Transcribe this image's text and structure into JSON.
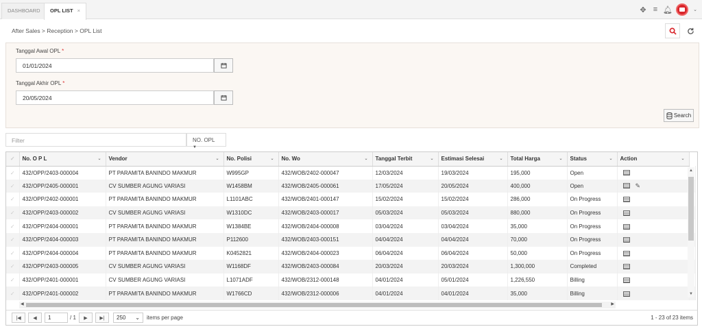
{
  "tabs": [
    {
      "label": "DASHBOARD"
    },
    {
      "label": "OPL LIST",
      "close": "×"
    }
  ],
  "breadcrumb": "After Sales > Reception > OPL List",
  "form": {
    "start_label": "Tanggal Awal OPL",
    "start_value": "01/01/2024",
    "end_label": "Tanggal Akhir OPL",
    "end_value": "20/05/2024",
    "required_mark": "*",
    "search_label": "Search"
  },
  "filter": {
    "placeholder": "Filter",
    "column": "NO. OPL"
  },
  "table": {
    "columns": [
      "No. O P L",
      "Vendor",
      "No. Polisi",
      "No. Wo",
      "Tanggal Terbit",
      "Estimasi Selesai",
      "Total Harga",
      "Status",
      "Action"
    ],
    "rows": [
      [
        "432/OPP/2403-000004",
        "PT PARAMITA BANINDO MAKMUR",
        "W995GP",
        "432/WOB/2402-000047",
        "12/03/2024",
        "19/03/2024",
        "195,000",
        "Open"
      ],
      [
        "432/OPP/2405-000001",
        "CV SUMBER AGUNG VARIASI",
        "W1458BM",
        "432/WOB/2405-000061",
        "17/05/2024",
        "20/05/2024",
        "400,000",
        "Open"
      ],
      [
        "432/OPP/2402-000001",
        "PT PARAMITA BANINDO MAKMUR",
        "L1101ABC",
        "432/WOB/2401-000147",
        "15/02/2024",
        "15/02/2024",
        "286,000",
        "On Progress"
      ],
      [
        "432/OPP/2403-000002",
        "CV SUMBER AGUNG VARIASI",
        "W1310DC",
        "432/WOB/2403-000017",
        "05/03/2024",
        "05/03/2024",
        "880,000",
        "On Progress"
      ],
      [
        "432/OPP/2404-000001",
        "PT PARAMITA BANINDO MAKMUR",
        "W1384BE",
        "432/WOB/2404-000008",
        "03/04/2024",
        "03/04/2024",
        "35,000",
        "On Progress"
      ],
      [
        "432/OPP/2404-000003",
        "PT PARAMITA BANINDO MAKMUR",
        "P112600",
        "432/WOB/2403-000151",
        "04/04/2024",
        "04/04/2024",
        "70,000",
        "On Progress"
      ],
      [
        "432/OPP/2404-000004",
        "PT PARAMITA BANINDO MAKMUR",
        "K0452821",
        "432/WOB/2404-000023",
        "06/04/2024",
        "06/04/2024",
        "50,000",
        "On Progress"
      ],
      [
        "432/OPP/2403-000005",
        "CV SUMBER AGUNG VARIASI",
        "W1168DF",
        "432/WOB/2403-000084",
        "20/03/2024",
        "20/03/2024",
        "1,300,000",
        "Completed"
      ],
      [
        "432/OPP/2401-000001",
        "CV SUMBER AGUNG VARIASI",
        "L1071ADF",
        "432/WOB/2312-000148",
        "04/01/2024",
        "05/01/2024",
        "1,226,550",
        "Billing"
      ],
      [
        "432/OPP/2401-000002",
        "PT PARAMITA BANINDO MAKMUR",
        "W1766CD",
        "432/WOB/2312-000006",
        "04/01/2024",
        "04/01/2024",
        "35,000",
        "Billing"
      ]
    ]
  },
  "pager": {
    "page": "1",
    "of": "/ 1",
    "page_size": "250",
    "per_page_label": "items per page",
    "summary": "1 - 23 of 23 items"
  }
}
